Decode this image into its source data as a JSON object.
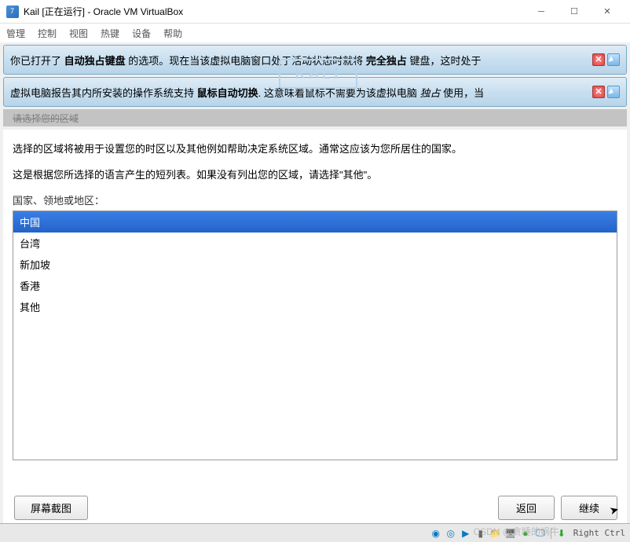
{
  "window": {
    "title": "Kail [正在运行] - Oracle VM VirtualBox"
  },
  "menu": {
    "manage": "管理",
    "control": "控制",
    "view": "视图",
    "hotkeys": "热键",
    "devices": "设备",
    "help": "帮助"
  },
  "notifications": {
    "n1_pre": "你已打开了 ",
    "n1_bold": "自动独占键盘",
    "n1_mid": " 的选项。现在当该虚拟电脑窗口处于活动状态时就将 ",
    "n1_bold2": "完全独占",
    "n1_end": " 键盘，这时处于",
    "n2_pre": "虚拟电脑报告其内所安装的操作系统支持 ",
    "n2_bold": "鼠标自动切换",
    "n2_mid": ". 这意味着鼠标不需要为该虚拟电脑 ",
    "n2_italic": "独占",
    "n2_end": " 使用，当"
  },
  "kali_logo": "KALI",
  "gray_strip": "请选择您的区域",
  "installer": {
    "desc1": "选择的区域将被用于设置您的时区以及其他例如帮助决定系统区域。通常这应该为您所居住的国家。",
    "desc2": "这是根据您所选择的语言产生的短列表。如果没有列出您的区域，请选择\"其他\"。",
    "list_label": "国家、领地或地区：",
    "regions": [
      "中国",
      "台湾",
      "新加坡",
      "香港",
      "其他"
    ],
    "selected_index": 0,
    "btn_screenshot": "屏幕截图",
    "btn_back": "返回",
    "btn_continue": "继续"
  },
  "status": {
    "host_key": "Right Ctrl",
    "watermark": "CSDN @贪睡的蜗牛"
  }
}
